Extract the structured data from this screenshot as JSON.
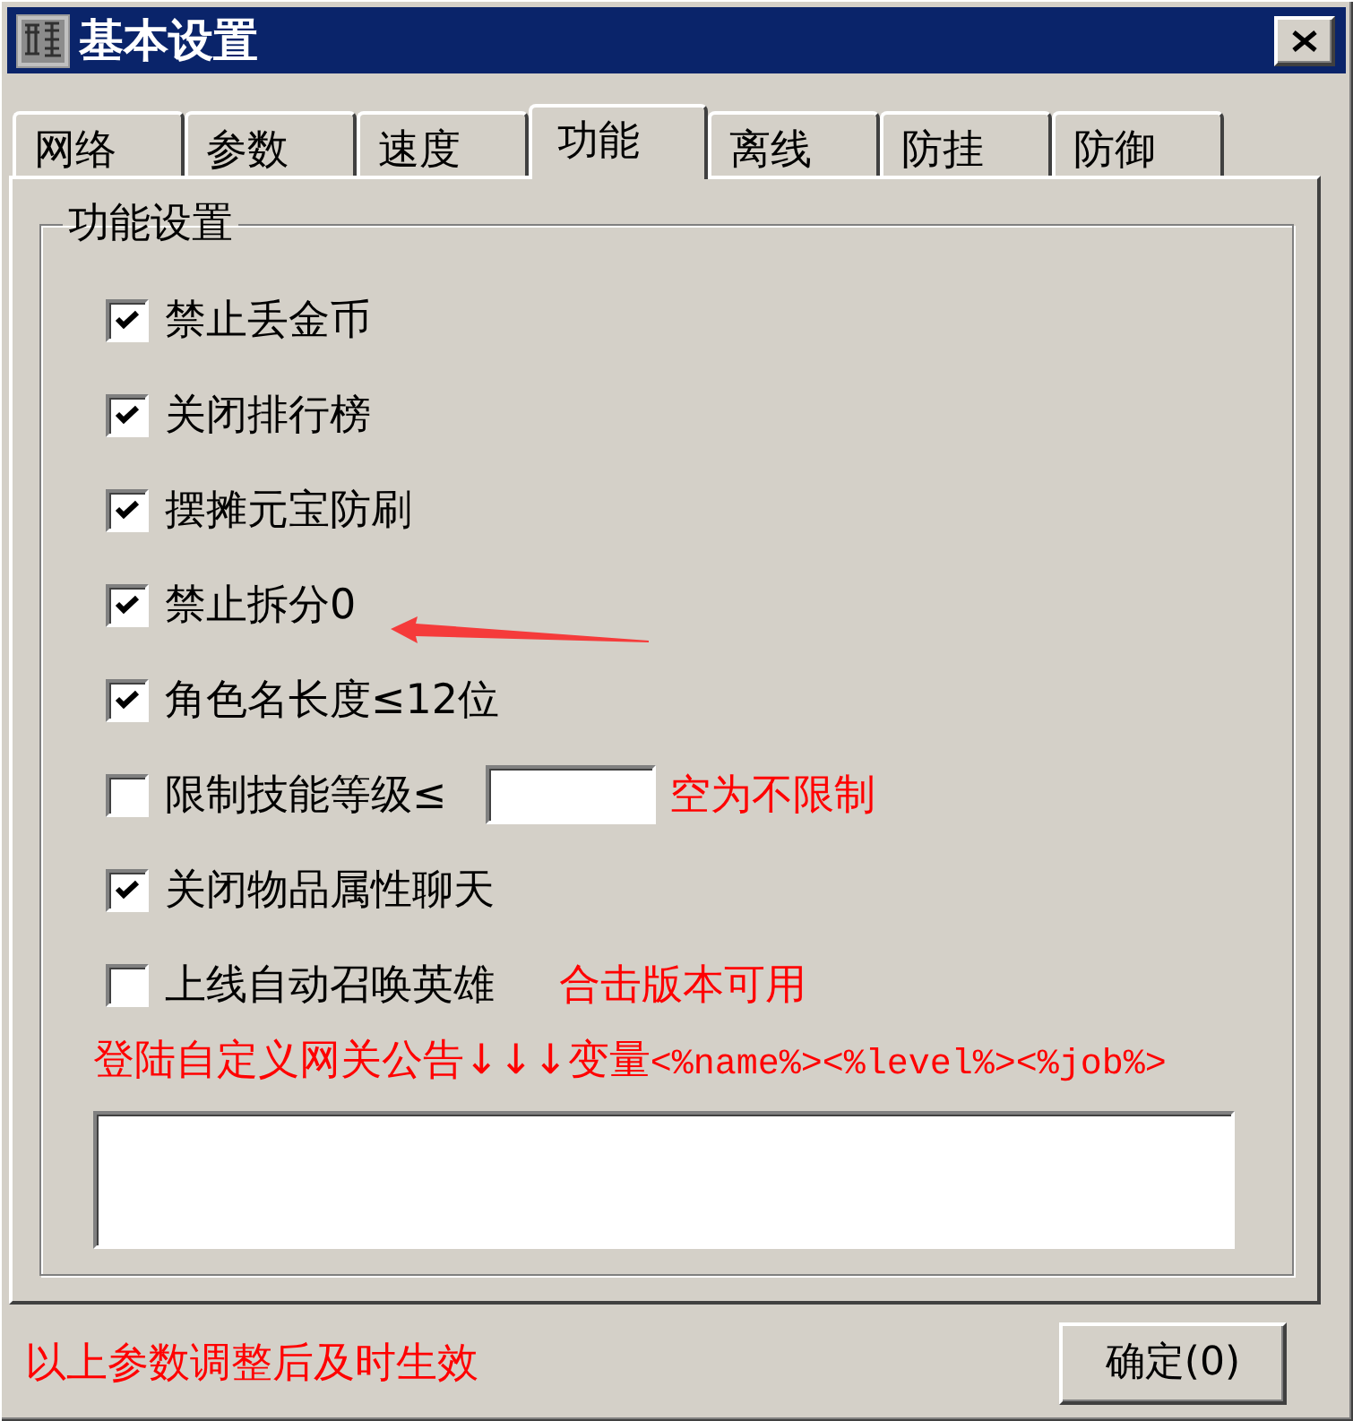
{
  "window": {
    "title": "基本设置"
  },
  "tabs": [
    {
      "label": "网络",
      "selected": false
    },
    {
      "label": "参数",
      "selected": false
    },
    {
      "label": "速度",
      "selected": false
    },
    {
      "label": "功能",
      "selected": true
    },
    {
      "label": "离线",
      "selected": false
    },
    {
      "label": "防挂",
      "selected": false
    },
    {
      "label": "防御",
      "selected": false
    }
  ],
  "group": {
    "title": "功能设置",
    "options": [
      {
        "kind": "checkbox",
        "label": "禁止丢金币",
        "checked": true
      },
      {
        "kind": "checkbox",
        "label": "关闭排行榜",
        "checked": true
      },
      {
        "kind": "checkbox",
        "label": "摆摊元宝防刷",
        "checked": true
      },
      {
        "kind": "checkbox",
        "label": "禁止拆分0",
        "checked": true
      },
      {
        "kind": "checkbox",
        "label": "角色名长度≤12位",
        "checked": true
      },
      {
        "kind": "input",
        "label": "限制技能等级≤",
        "checked": false,
        "note": "空为不限制"
      },
      {
        "kind": "checkbox",
        "label": "关闭物品属性聊天",
        "checked": true
      },
      {
        "kind": "note",
        "label": "上线自动召唤英雄",
        "checked": false,
        "note": "合击版本可用"
      }
    ],
    "announcement": {
      "label": "登陆自定义网关公告↓↓↓变量",
      "variables": "<%name%><%level%><%job%>"
    }
  },
  "footer": {
    "notice": "以上参数调整后及时生效",
    "button": "确定(0)"
  }
}
